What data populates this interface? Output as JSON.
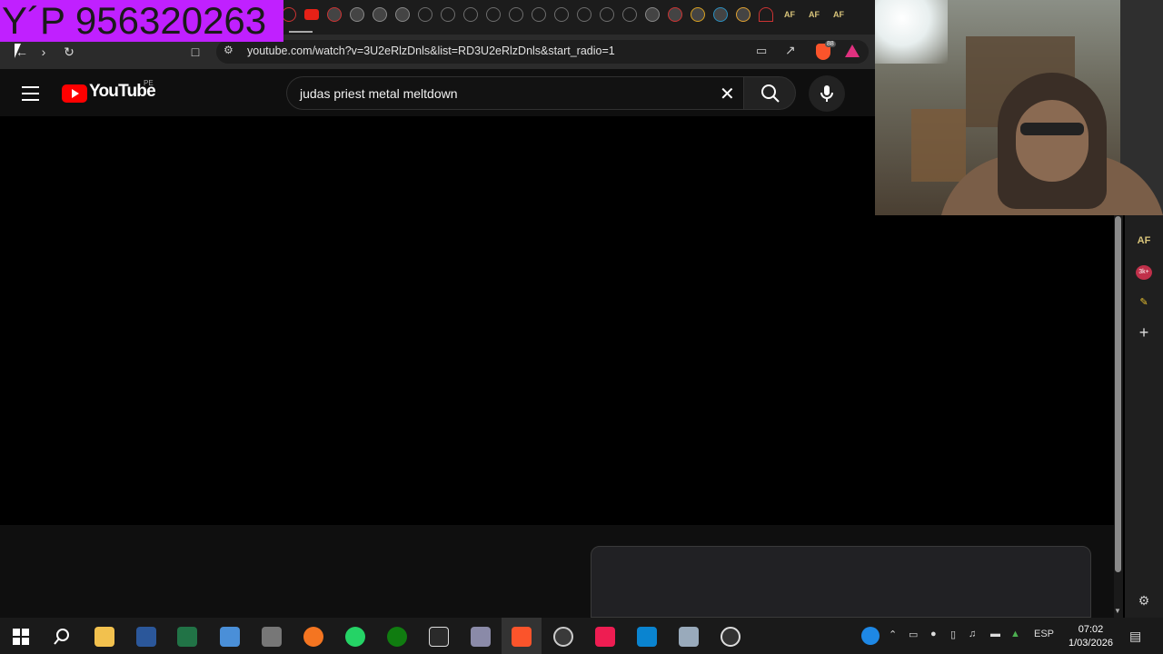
{
  "overlay": {
    "phone_text": "Y´P 956320263"
  },
  "browser": {
    "url": "youtube.com/watch?v=3U2eRlzDnls&list=RD3U2eRlzDnls&start_radio=1",
    "brave_badge": "88",
    "tab_icons": [
      "youtube-icon",
      "record-icon",
      "radio-icon",
      "radio-icon",
      "radio-icon",
      "loading-icon",
      "loading-icon",
      "loading-icon",
      "loading-icon",
      "loading-icon",
      "loading-icon",
      "loading-icon",
      "loading-icon",
      "loading-icon",
      "loading-icon",
      "loading-icon",
      "chrome-icon",
      "red-icon",
      "s-icon",
      "blue-icon",
      "orange-icon",
      "red-arrow-icon",
      "af-icon",
      "af-icon",
      "af-icon",
      "af-icon"
    ],
    "af_label": "AF"
  },
  "youtube": {
    "logo_text": "YouTube",
    "region": "PE",
    "search_query": "judas priest metal meltdown"
  },
  "side_panel": {
    "af_label": "AF",
    "badge_label": "3k+"
  },
  "taskbar": {
    "language": "ESP",
    "time": "07:02",
    "date": "1/03/2026",
    "apps": [
      "windows-start",
      "search",
      "file-explorer",
      "word",
      "excel",
      "calculator",
      "clapperboard",
      "crunchyroll",
      "whatsapp",
      "xbox",
      "epic-games",
      "game-controller",
      "brave",
      "obs",
      "tiktok",
      "mail",
      "snipping",
      "obs-studio"
    ]
  },
  "colors": {
    "overlay_bg": "#c020ff",
    "youtube_red": "#ff0000",
    "page_bg": "#0f0f0f"
  }
}
